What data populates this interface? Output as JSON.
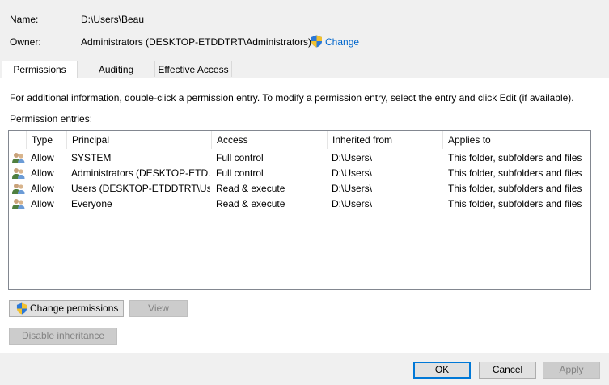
{
  "summary": {
    "name_label": "Name:",
    "name_value": "D:\\Users\\Beau",
    "owner_label": "Owner:",
    "owner_value": "Administrators (DESKTOP-ETDDTRT\\Administrators)",
    "change_link": "Change"
  },
  "tabs": [
    {
      "label": "Permissions",
      "active": true
    },
    {
      "label": "Auditing",
      "active": false
    },
    {
      "label": "Effective Access",
      "active": false
    }
  ],
  "info_text": "For additional information, double-click a permission entry. To modify a permission entry, select the entry and click Edit (if available).",
  "entries_label": "Permission entries:",
  "columns": [
    "Type",
    "Principal",
    "Access",
    "Inherited from",
    "Applies to"
  ],
  "rows": [
    {
      "type": "Allow",
      "principal": "SYSTEM",
      "access": "Full control",
      "inherited": "D:\\Users\\",
      "applies": "This folder, subfolders and files"
    },
    {
      "type": "Allow",
      "principal": "Administrators (DESKTOP-ETD...",
      "access": "Full control",
      "inherited": "D:\\Users\\",
      "applies": "This folder, subfolders and files"
    },
    {
      "type": "Allow",
      "principal": "Users (DESKTOP-ETDDTRT\\Use...",
      "access": "Read & execute",
      "inherited": "D:\\Users\\",
      "applies": "This folder, subfolders and files"
    },
    {
      "type": "Allow",
      "principal": "Everyone",
      "access": "Read & execute",
      "inherited": "D:\\Users\\",
      "applies": "This folder, subfolders and files"
    }
  ],
  "buttons": {
    "change_permissions": "Change permissions",
    "view": "View",
    "disable_inheritance": "Disable inheritance",
    "ok": "OK",
    "cancel": "Cancel",
    "apply": "Apply"
  },
  "icons": {
    "shield": "uac-shield-icon",
    "user_group": "user-group-icon"
  },
  "colors": {
    "link": "#0066cc",
    "default_button_border": "#0078d7"
  }
}
